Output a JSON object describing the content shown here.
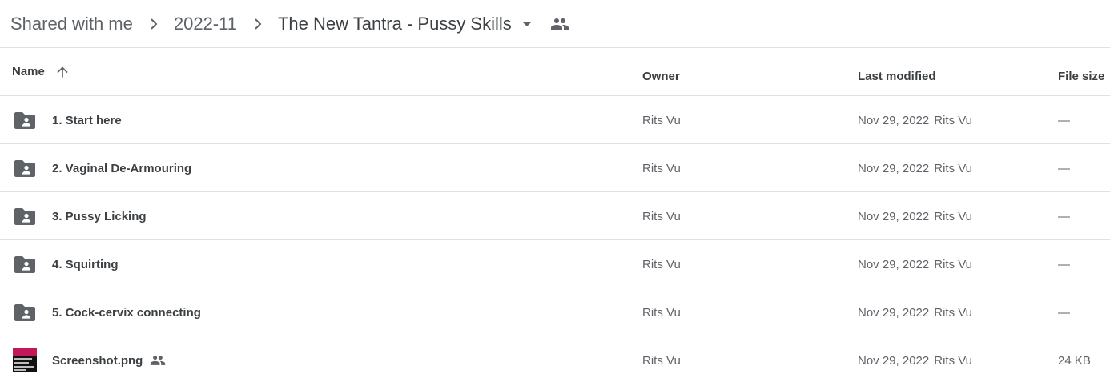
{
  "breadcrumb": {
    "items": [
      "Shared with me",
      "2022-11"
    ],
    "current": "The New Tantra - Pussy Skills"
  },
  "columns": {
    "name": "Name",
    "owner": "Owner",
    "modified": "Last modified",
    "size": "File size"
  },
  "icons": {
    "separator": "chevron-right-icon",
    "dropdown": "arrow-drop-down-icon",
    "shared": "people-icon",
    "sort": "arrow-upward-icon",
    "folder": "shared-folder-icon",
    "image": "image-thumbnail"
  },
  "colors": {
    "icon": "#5f6368",
    "thumb_accent": "#c2185b"
  },
  "files": [
    {
      "name": "1. Start here",
      "owner": "Rits Vu",
      "modified_date": "Nov 29, 2022",
      "modified_by": "Rits Vu",
      "size": "—",
      "type": "folder"
    },
    {
      "name": "2. Vaginal De-Armouring",
      "owner": "Rits Vu",
      "modified_date": "Nov 29, 2022",
      "modified_by": "Rits Vu",
      "size": "—",
      "type": "folder"
    },
    {
      "name": "3. Pussy Licking",
      "owner": "Rits Vu",
      "modified_date": "Nov 29, 2022",
      "modified_by": "Rits Vu",
      "size": "—",
      "type": "folder"
    },
    {
      "name": "4. Squirting",
      "owner": "Rits Vu",
      "modified_date": "Nov 29, 2022",
      "modified_by": "Rits Vu",
      "size": "—",
      "type": "folder"
    },
    {
      "name": "5. Cock-cervix connecting",
      "owner": "Rits Vu",
      "modified_date": "Nov 29, 2022",
      "modified_by": "Rits Vu",
      "size": "—",
      "type": "folder"
    },
    {
      "name": "Screenshot.png",
      "owner": "Rits Vu",
      "modified_date": "Nov 29, 2022",
      "modified_by": "Rits Vu",
      "size": "24 KB",
      "type": "image",
      "shared": true
    }
  ]
}
